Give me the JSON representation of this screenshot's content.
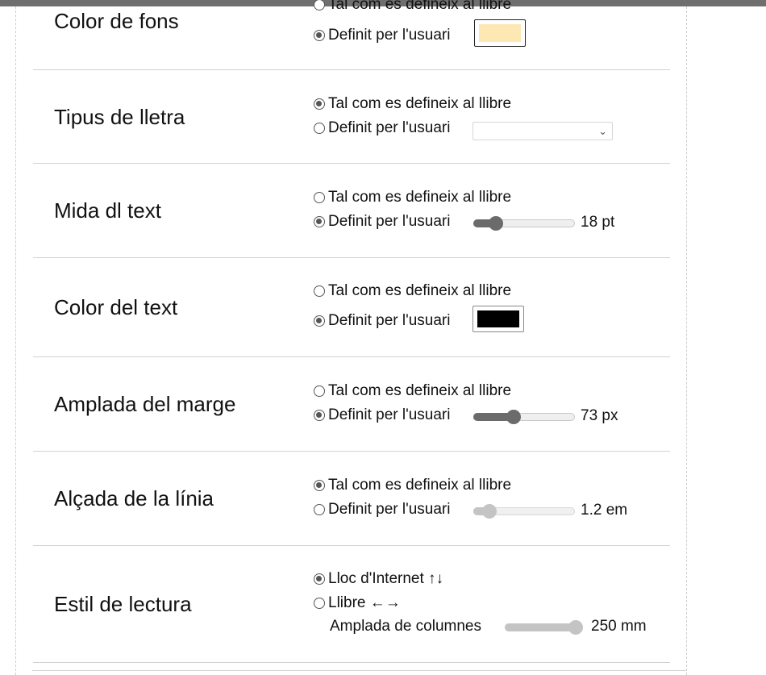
{
  "settings": {
    "background_color": {
      "label": "Color de fons",
      "option_book": "Tal com es defineix al llibre",
      "option_user": "Definit per l'usuari",
      "selected": "user",
      "color": "#fde8b4"
    },
    "font": {
      "label": "Tipus de lletra",
      "option_book": "Tal com es defineix al llibre",
      "option_user": "Definit per l'usuari",
      "selected": "book",
      "value": ""
    },
    "text_size": {
      "label": "Mida dl text",
      "option_book": "Tal com es defineix al llibre",
      "option_user": "Definit per l'usuari",
      "selected": "user",
      "value_text": "18 pt",
      "level": 0.18
    },
    "text_color": {
      "label": "Color del text",
      "option_book": "Tal com es defineix al llibre",
      "option_user": "Definit per l'usuari",
      "selected": "user",
      "color": "#000000"
    },
    "margin_width": {
      "label": "Amplada del marge",
      "option_book": "Tal com es defineix al llibre",
      "option_user": "Definit per l'usuari",
      "selected": "user",
      "value_text": "73 px",
      "level": 0.38
    },
    "line_height": {
      "label": "Alçada de la línia",
      "option_book": "Tal com es defineix al llibre",
      "option_user": "Definit per l'usuari",
      "selected": "book",
      "value_text": "1.2 em",
      "level": 0.1
    },
    "reading_style": {
      "label": "Estil de lectura",
      "option_internet": "Lloc d'Internet ↑↓",
      "option_book": "Llibre ←→",
      "selected": "internet",
      "columns_label": "Amplada de columnes",
      "columns_value_text": "250 mm",
      "columns_level": 1.0
    }
  },
  "colors": {
    "top_bar": "#6f6f6f",
    "slider_active": "#6b6b6b",
    "slider_disabled": "#c4c4c4",
    "divider": "#d2d2d2"
  }
}
